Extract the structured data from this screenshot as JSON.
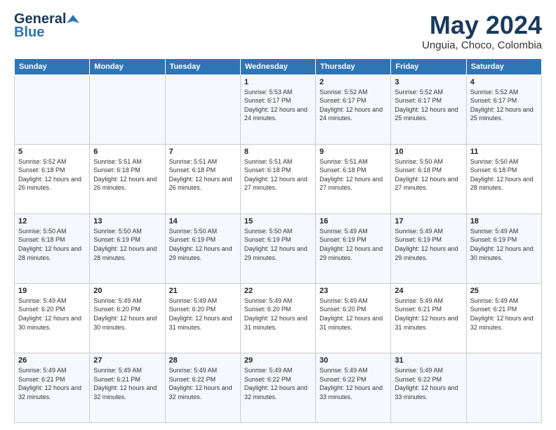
{
  "header": {
    "logo_line1": "General",
    "logo_line2": "Blue",
    "month": "May 2024",
    "location": "Unguia, Choco, Colombia"
  },
  "weekdays": [
    "Sunday",
    "Monday",
    "Tuesday",
    "Wednesday",
    "Thursday",
    "Friday",
    "Saturday"
  ],
  "weeks": [
    [
      {
        "day": "",
        "sunrise": "",
        "sunset": "",
        "daylight": ""
      },
      {
        "day": "",
        "sunrise": "",
        "sunset": "",
        "daylight": ""
      },
      {
        "day": "",
        "sunrise": "",
        "sunset": "",
        "daylight": ""
      },
      {
        "day": "1",
        "sunrise": "Sunrise: 5:53 AM",
        "sunset": "Sunset: 6:17 PM",
        "daylight": "Daylight: 12 hours and 24 minutes."
      },
      {
        "day": "2",
        "sunrise": "Sunrise: 5:52 AM",
        "sunset": "Sunset: 6:17 PM",
        "daylight": "Daylight: 12 hours and 24 minutes."
      },
      {
        "day": "3",
        "sunrise": "Sunrise: 5:52 AM",
        "sunset": "Sunset: 6:17 PM",
        "daylight": "Daylight: 12 hours and 25 minutes."
      },
      {
        "day": "4",
        "sunrise": "Sunrise: 5:52 AM",
        "sunset": "Sunset: 6:17 PM",
        "daylight": "Daylight: 12 hours and 25 minutes."
      }
    ],
    [
      {
        "day": "5",
        "sunrise": "Sunrise: 5:52 AM",
        "sunset": "Sunset: 6:18 PM",
        "daylight": "Daylight: 12 hours and 26 minutes."
      },
      {
        "day": "6",
        "sunrise": "Sunrise: 5:51 AM",
        "sunset": "Sunset: 6:18 PM",
        "daylight": "Daylight: 12 hours and 26 minutes."
      },
      {
        "day": "7",
        "sunrise": "Sunrise: 5:51 AM",
        "sunset": "Sunset: 6:18 PM",
        "daylight": "Daylight: 12 hours and 26 minutes."
      },
      {
        "day": "8",
        "sunrise": "Sunrise: 5:51 AM",
        "sunset": "Sunset: 6:18 PM",
        "daylight": "Daylight: 12 hours and 27 minutes."
      },
      {
        "day": "9",
        "sunrise": "Sunrise: 5:51 AM",
        "sunset": "Sunset: 6:18 PM",
        "daylight": "Daylight: 12 hours and 27 minutes."
      },
      {
        "day": "10",
        "sunrise": "Sunrise: 5:50 AM",
        "sunset": "Sunset: 6:18 PM",
        "daylight": "Daylight: 12 hours and 27 minutes."
      },
      {
        "day": "11",
        "sunrise": "Sunrise: 5:50 AM",
        "sunset": "Sunset: 6:18 PM",
        "daylight": "Daylight: 12 hours and 28 minutes."
      }
    ],
    [
      {
        "day": "12",
        "sunrise": "Sunrise: 5:50 AM",
        "sunset": "Sunset: 6:18 PM",
        "daylight": "Daylight: 12 hours and 28 minutes."
      },
      {
        "day": "13",
        "sunrise": "Sunrise: 5:50 AM",
        "sunset": "Sunset: 6:19 PM",
        "daylight": "Daylight: 12 hours and 28 minutes."
      },
      {
        "day": "14",
        "sunrise": "Sunrise: 5:50 AM",
        "sunset": "Sunset: 6:19 PM",
        "daylight": "Daylight: 12 hours and 29 minutes."
      },
      {
        "day": "15",
        "sunrise": "Sunrise: 5:50 AM",
        "sunset": "Sunset: 6:19 PM",
        "daylight": "Daylight: 12 hours and 29 minutes."
      },
      {
        "day": "16",
        "sunrise": "Sunrise: 5:49 AM",
        "sunset": "Sunset: 6:19 PM",
        "daylight": "Daylight: 12 hours and 29 minutes."
      },
      {
        "day": "17",
        "sunrise": "Sunrise: 5:49 AM",
        "sunset": "Sunset: 6:19 PM",
        "daylight": "Daylight: 12 hours and 29 minutes."
      },
      {
        "day": "18",
        "sunrise": "Sunrise: 5:49 AM",
        "sunset": "Sunset: 6:19 PM",
        "daylight": "Daylight: 12 hours and 30 minutes."
      }
    ],
    [
      {
        "day": "19",
        "sunrise": "Sunrise: 5:49 AM",
        "sunset": "Sunset: 6:20 PM",
        "daylight": "Daylight: 12 hours and 30 minutes."
      },
      {
        "day": "20",
        "sunrise": "Sunrise: 5:49 AM",
        "sunset": "Sunset: 6:20 PM",
        "daylight": "Daylight: 12 hours and 30 minutes."
      },
      {
        "day": "21",
        "sunrise": "Sunrise: 5:49 AM",
        "sunset": "Sunset: 6:20 PM",
        "daylight": "Daylight: 12 hours and 31 minutes."
      },
      {
        "day": "22",
        "sunrise": "Sunrise: 5:49 AM",
        "sunset": "Sunset: 6:20 PM",
        "daylight": "Daylight: 12 hours and 31 minutes."
      },
      {
        "day": "23",
        "sunrise": "Sunrise: 5:49 AM",
        "sunset": "Sunset: 6:20 PM",
        "daylight": "Daylight: 12 hours and 31 minutes."
      },
      {
        "day": "24",
        "sunrise": "Sunrise: 5:49 AM",
        "sunset": "Sunset: 6:21 PM",
        "daylight": "Daylight: 12 hours and 31 minutes."
      },
      {
        "day": "25",
        "sunrise": "Sunrise: 5:49 AM",
        "sunset": "Sunset: 6:21 PM",
        "daylight": "Daylight: 12 hours and 32 minutes."
      }
    ],
    [
      {
        "day": "26",
        "sunrise": "Sunrise: 5:49 AM",
        "sunset": "Sunset: 6:21 PM",
        "daylight": "Daylight: 12 hours and 32 minutes."
      },
      {
        "day": "27",
        "sunrise": "Sunrise: 5:49 AM",
        "sunset": "Sunset: 6:21 PM",
        "daylight": "Daylight: 12 hours and 32 minutes."
      },
      {
        "day": "28",
        "sunrise": "Sunrise: 5:49 AM",
        "sunset": "Sunset: 6:22 PM",
        "daylight": "Daylight: 12 hours and 32 minutes."
      },
      {
        "day": "29",
        "sunrise": "Sunrise: 5:49 AM",
        "sunset": "Sunset: 6:22 PM",
        "daylight": "Daylight: 12 hours and 32 minutes."
      },
      {
        "day": "30",
        "sunrise": "Sunrise: 5:49 AM",
        "sunset": "Sunset: 6:22 PM",
        "daylight": "Daylight: 12 hours and 33 minutes."
      },
      {
        "day": "31",
        "sunrise": "Sunrise: 5:49 AM",
        "sunset": "Sunset: 6:22 PM",
        "daylight": "Daylight: 12 hours and 33 minutes."
      },
      {
        "day": "",
        "sunrise": "",
        "sunset": "",
        "daylight": ""
      }
    ]
  ]
}
